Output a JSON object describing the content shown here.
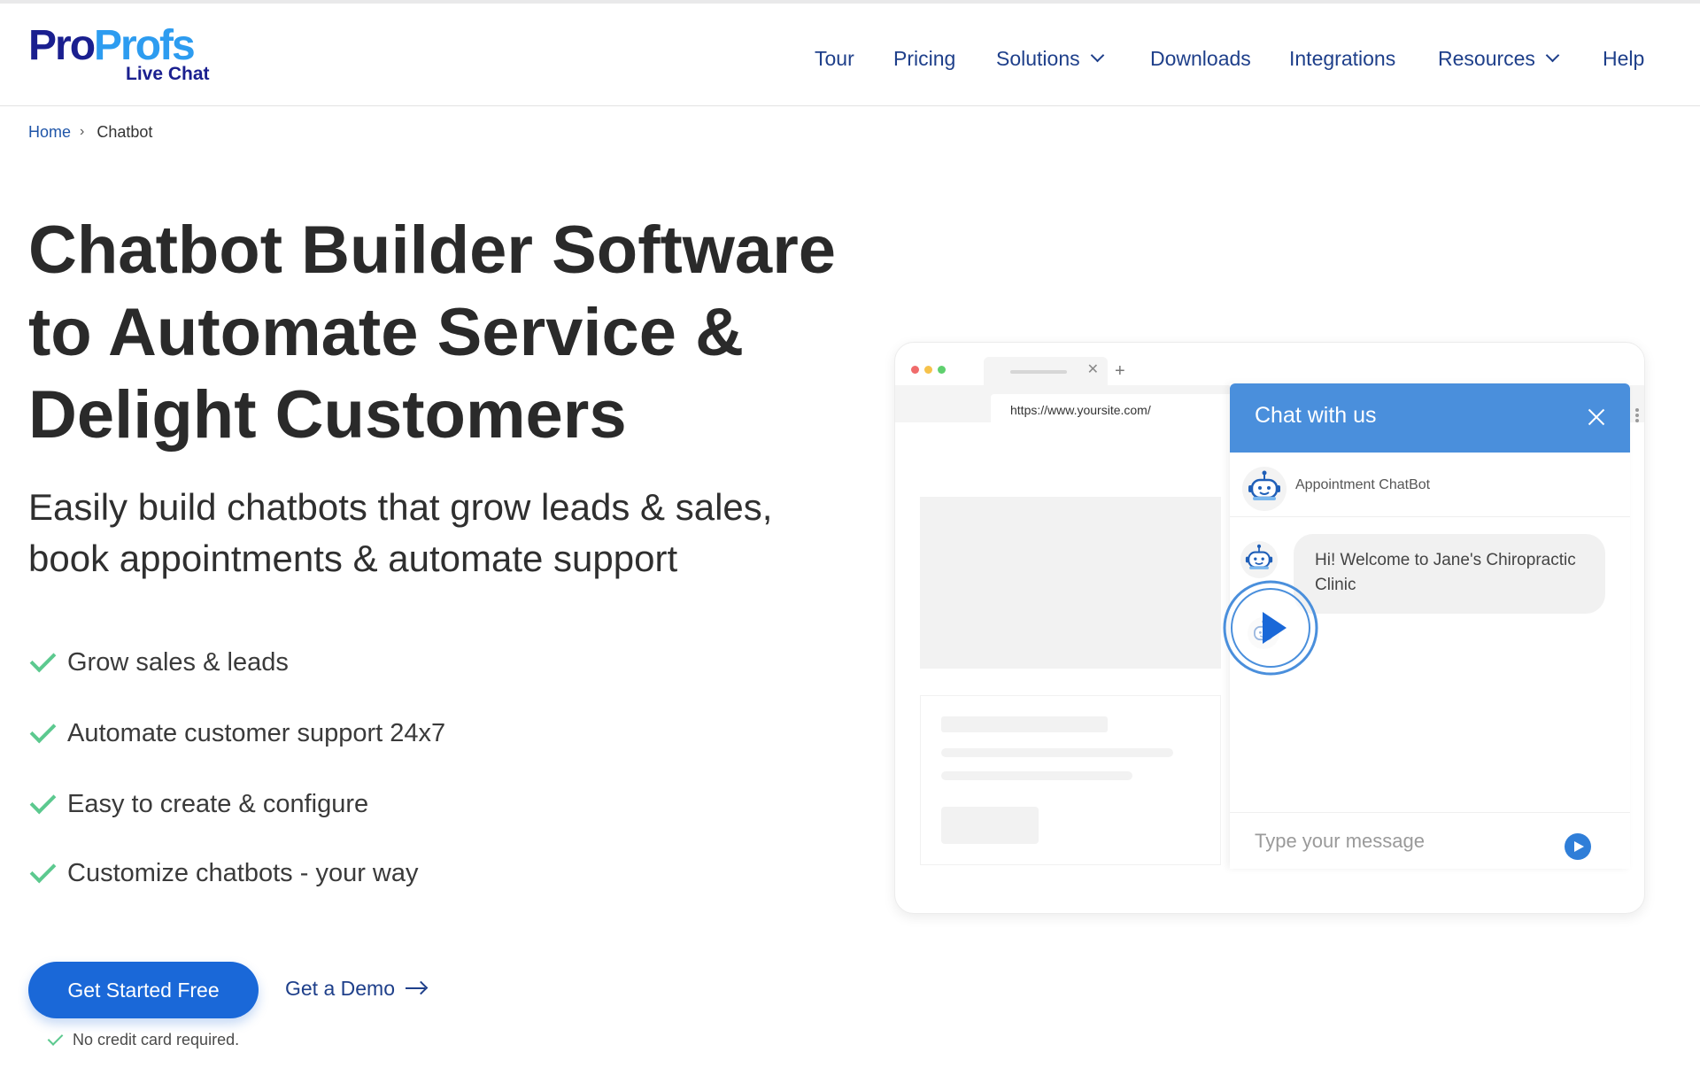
{
  "brand": {
    "name_part1": "Pro",
    "name_part2": "Profs",
    "product": "Live Chat",
    "color_primary": "#1a1f8f",
    "color_secondary": "#2d9cf0"
  },
  "nav": {
    "items": [
      {
        "label": "Tour",
        "dropdown": false
      },
      {
        "label": "Pricing",
        "dropdown": false
      },
      {
        "label": "Solutions",
        "dropdown": true
      },
      {
        "label": "Downloads",
        "dropdown": false
      },
      {
        "label": "Integrations",
        "dropdown": false
      },
      {
        "label": "Resources",
        "dropdown": true
      },
      {
        "label": "Help",
        "dropdown": false
      }
    ]
  },
  "breadcrumb": {
    "home": "Home",
    "separator": "›",
    "current": "Chatbot"
  },
  "hero": {
    "title": "Chatbot Builder Software to Automate Service & Delight Customers",
    "subtitle": "Easily build chatbots that grow leads & sales, book appointments & automate support",
    "features": [
      "Grow sales & leads",
      "Automate customer support 24x7",
      "Easy to create & configure",
      "Customize chatbots - your way"
    ],
    "cta_primary": "Get Started Free",
    "cta_secondary": "Get a Demo",
    "note": "No credit card required.",
    "accent_color": "#1a68d8",
    "check_color": "#5cc98f"
  },
  "mockup": {
    "url": "https://www.yoursite.com/",
    "chat_title": "Chat with us",
    "bot_name": "Appointment ChatBot",
    "bot_message": "Hi! Welcome to Jane's Chiropractic Clinic",
    "input_placeholder": "Type your message",
    "header_color": "#4a8fdc"
  }
}
